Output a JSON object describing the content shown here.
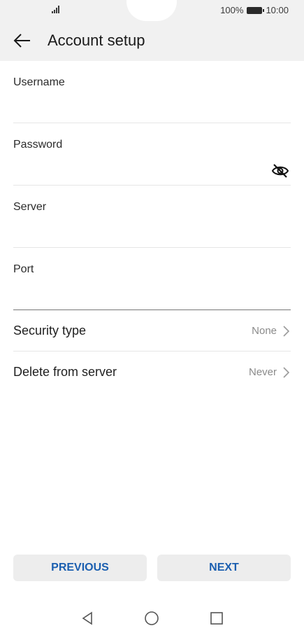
{
  "status_bar": {
    "battery_percent": "100%",
    "time": "10:00"
  },
  "header": {
    "title": "Account setup"
  },
  "form": {
    "fields": [
      {
        "label": "Username",
        "value": ""
      },
      {
        "label": "Password",
        "value": ""
      },
      {
        "label": "Server",
        "value": ""
      },
      {
        "label": "Port",
        "value": ""
      }
    ],
    "settings": [
      {
        "label": "Security type",
        "value": "None"
      },
      {
        "label": "Delete from server",
        "value": "Never"
      }
    ]
  },
  "buttons": {
    "previous": "PREVIOUS",
    "next": "NEXT"
  },
  "colors": {
    "accent": "#1b5fb0",
    "header_bg": "#f1f1f1"
  },
  "icons": {
    "back": "arrow-left-icon",
    "password_toggle": "eye-off-icon",
    "nav_back": "triangle-back-icon",
    "nav_home": "circle-home-icon",
    "nav_recents": "square-recents-icon"
  }
}
